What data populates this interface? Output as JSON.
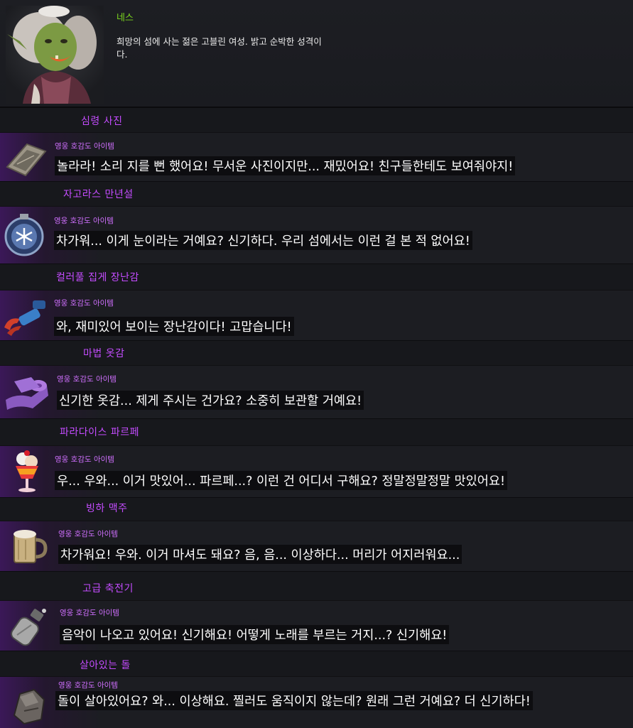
{
  "npc": {
    "name": "네스",
    "description": "희망의 섬에 사는 젊은 고블린 여성. 밝고 순박한 성격이다."
  },
  "items": [
    {
      "title": "심령 사진",
      "subtitle": "영웅 호감도 아이템",
      "dialogue": "놀라라! 소리 지를 뻔 했어요! 무서운 사진이지만... 재밌어요! 친구들한테도 보여줘야지!",
      "icon": "photo-icon"
    },
    {
      "title": "자고라스 만년설",
      "subtitle": "영웅 호감도 아이템",
      "dialogue": "차가워... 이게 눈이라는 거예요? 신기하다. 우리 섬에서는 이런 걸 본 적 없어요!",
      "icon": "snow-orb-icon"
    },
    {
      "title": "컬러풀 집게 장난감",
      "subtitle": "영웅 호감도 아이템",
      "dialogue": "와, 재미있어 보이는 장난감이다! 고맙습니다!",
      "icon": "claw-toy-icon"
    },
    {
      "title": "마법 옷감",
      "subtitle": "영웅 호감도 아이템",
      "dialogue": "신기한 옷감... 제게 주시는 건가요? 소중히 보관할 거예요!",
      "icon": "fabric-icon"
    },
    {
      "title": "파라다이스 파르페",
      "subtitle": "영웅 호감도 아이템",
      "dialogue": "우... 우와... 이거 맛있어... 파르페...? 이런 건 어디서 구해요? 정말정말정말 맛있어요!",
      "icon": "parfait-icon"
    },
    {
      "title": "빙하 맥주",
      "subtitle": "영웅 호감도 아이템",
      "dialogue": "차가워요! 우와. 이거 마셔도 돼요? 음, 음... 이상하다... 머리가 어지러워요...",
      "icon": "beer-mug-icon"
    },
    {
      "title": "고급 축전기",
      "subtitle": "영웅 호감도 아이템",
      "dialogue": "음악이 나오고 있어요! 신기해요! 어떻게 노래를 부르는 거지...? 신기해요!",
      "icon": "capacitor-icon"
    },
    {
      "title": "살아있는 돌",
      "subtitle": "영웅 호감도 아이템",
      "dialogue": "돌이 살아있어요? 와... 이상해요. 찔러도 움직이지 않는데? 원래 그런 거예요? 더 신기하다!",
      "icon": "stone-icon"
    }
  ]
}
